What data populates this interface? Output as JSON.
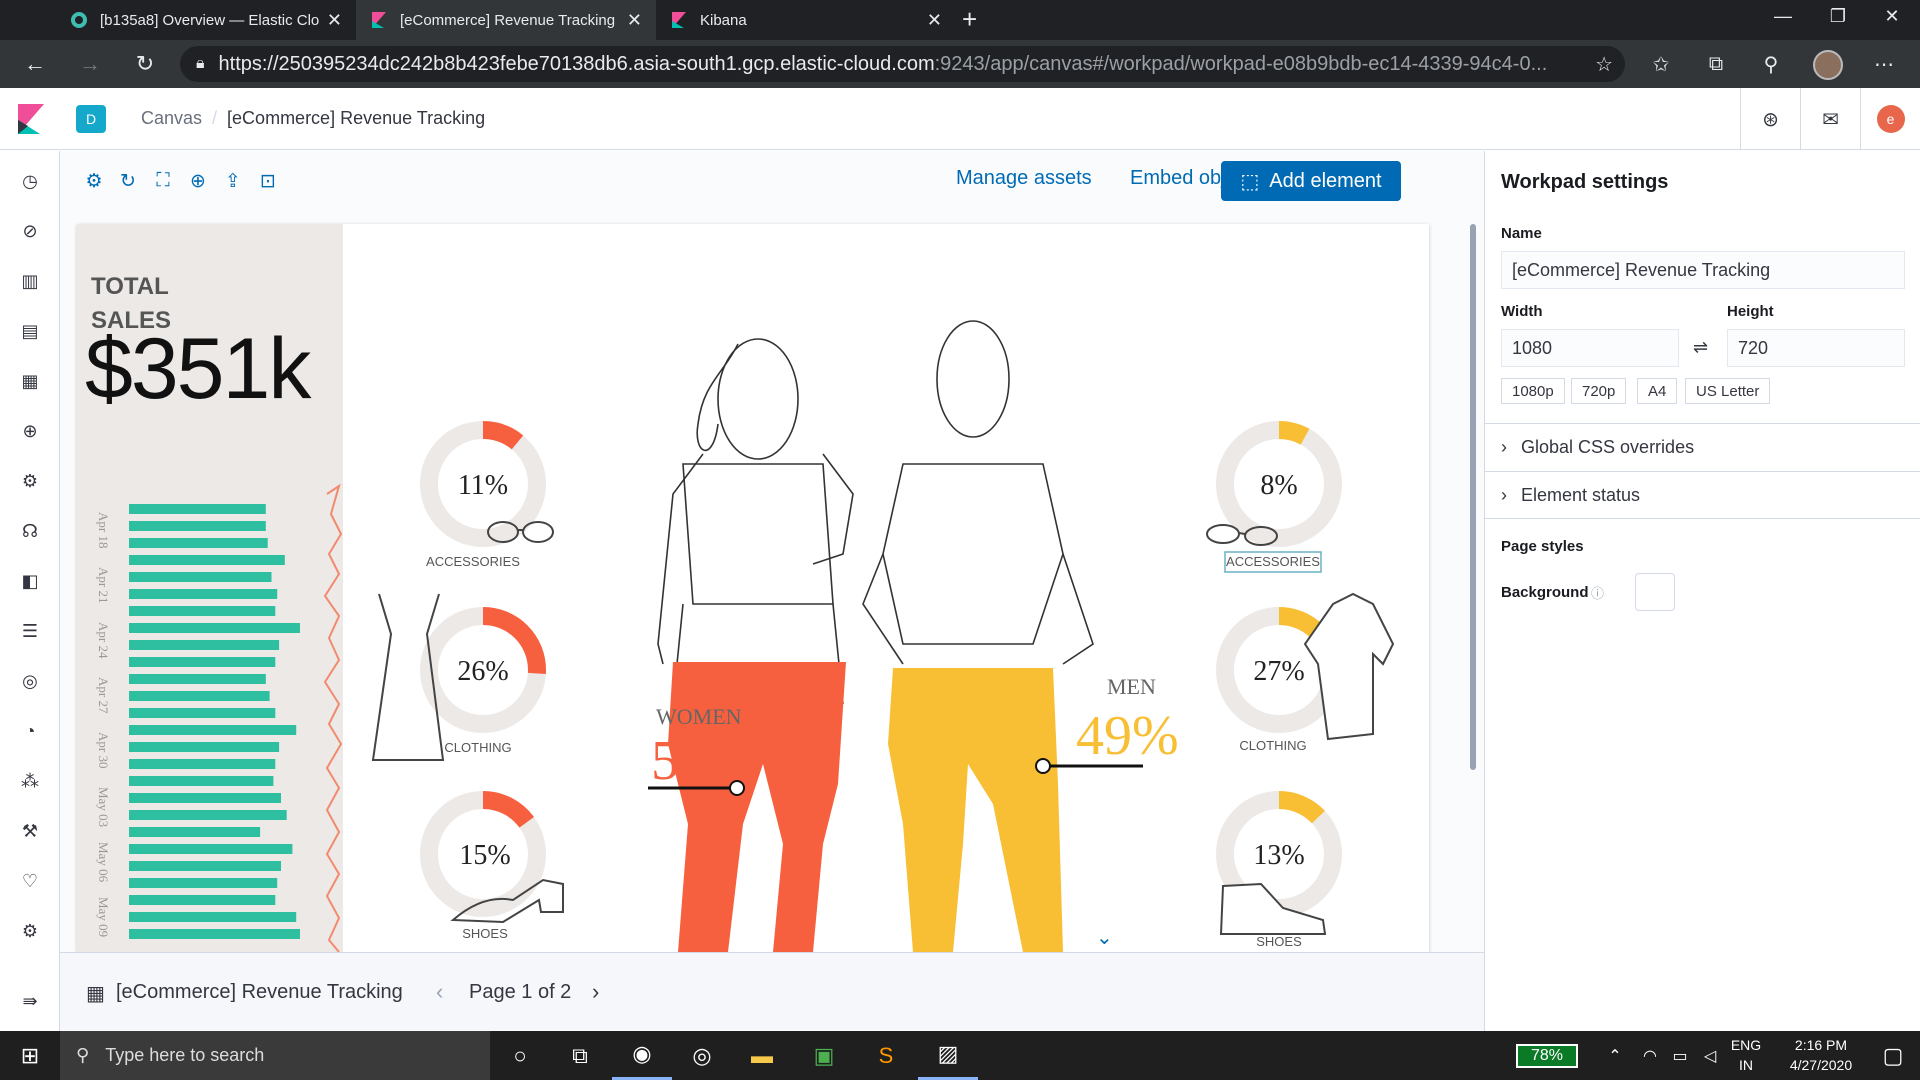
{
  "browser": {
    "tabs": [
      {
        "title": "[b135a8] Overview — Elastic Clo",
        "close": "✕"
      },
      {
        "title": "[eCommerce] Revenue Tracking",
        "close": "✕"
      },
      {
        "title": "Kibana",
        "close": "✕"
      }
    ],
    "url_host": "https://250395234dc242b8b423febe70138db6.asia-south1.gcp.elastic-cloud.com",
    "url_path": ":9243/app/canvas#/workpad/workpad-e08b9bdb-ec14-4339-94c4-0..."
  },
  "header": {
    "space_initial": "D",
    "breadcrumbs": [
      "Canvas",
      "[eCommerce] Revenue Tracking"
    ],
    "user_initial": "e"
  },
  "toolbar": {
    "manage_assets": "Manage assets",
    "embed_object": "Embed object",
    "add_element": "Add element"
  },
  "workpad": {
    "total_label": "TOTAL SALES",
    "total_value": "$351k",
    "dates": [
      "Apr 18",
      "Apr 21",
      "Apr 24",
      "Apr 27",
      "Apr 30",
      "May 03",
      "May 06",
      "May 09"
    ],
    "women": {
      "label": "WOMEN",
      "pct": "51%"
    },
    "men": {
      "label": "MEN",
      "pct": "49%"
    },
    "women_categories": [
      {
        "pct": "11%",
        "label": "ACCESSORIES",
        "value": 0.11
      },
      {
        "pct": "26%",
        "label": "CLOTHING",
        "value": 0.26
      },
      {
        "pct": "15%",
        "label": "SHOES",
        "value": 0.15
      }
    ],
    "men_categories": [
      {
        "pct": "8%",
        "label": "ACCESSORIES",
        "value": 0.08
      },
      {
        "pct": "27%",
        "label": "CLOTHING",
        "value": 0.27
      },
      {
        "pct": "13%",
        "label": "SHOES",
        "value": 0.13
      }
    ],
    "colors": {
      "women": "#f7603e",
      "men": "#f8be34",
      "bars": "#2dbf9f",
      "panel": "#ede9e7"
    }
  },
  "chart_data": {
    "type": "bar",
    "bar_count": 26,
    "values": [
      0.72,
      0.72,
      0.73,
      0.82,
      0.75,
      0.78,
      0.77,
      0.9,
      0.79,
      0.77,
      0.72,
      0.74,
      0.77,
      0.88,
      0.79,
      0.77,
      0.76,
      0.8,
      0.83,
      0.69,
      0.86,
      0.8,
      0.78,
      0.77,
      0.88,
      0.9
    ]
  },
  "pagination": {
    "workpad_name": "[eCommerce] Revenue Tracking",
    "page": "Page 1 of 2"
  },
  "settings": {
    "title": "Workpad settings",
    "name_label": "Name",
    "name_value": "[eCommerce] Revenue Tracking",
    "width_label": "Width",
    "width_value": "1080",
    "height_label": "Height",
    "height_value": "720",
    "presets": [
      "1080p",
      "720p",
      "A4",
      "US Letter"
    ],
    "global_css": "Global CSS overrides",
    "element_status": "Element status",
    "page_styles": "Page styles",
    "background_label": "Background"
  },
  "taskbar": {
    "search_placeholder": "Type here to search",
    "battery": "78%",
    "lang": "ENG",
    "region": "IN",
    "time": "2:16 PM",
    "date": "4/27/2020"
  }
}
